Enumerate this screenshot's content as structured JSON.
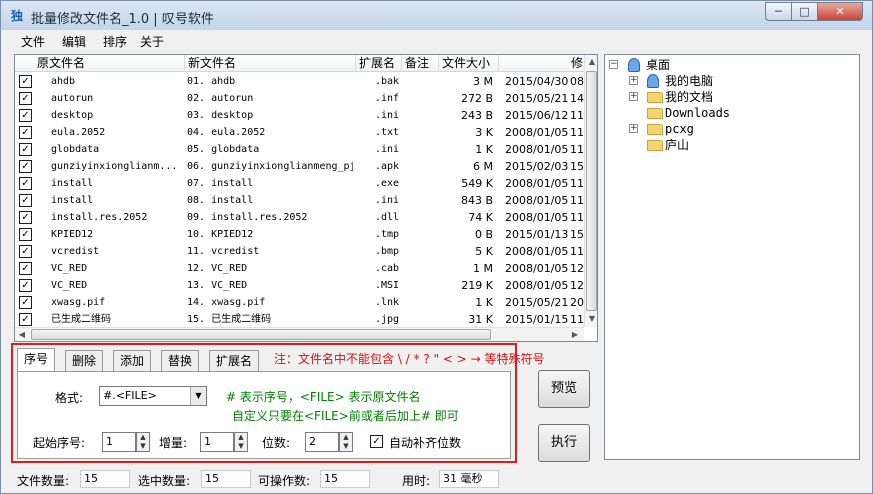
{
  "window": {
    "title": "批量修改文件名_1.0 | 叹号软件",
    "icon_glyph": "独",
    "min_label": "─",
    "max_label": "□",
    "close_label": "✕"
  },
  "menu": [
    "文件",
    "编辑",
    "排序",
    "关于"
  ],
  "columns": [
    "原文件名",
    "新文件名",
    "扩展名",
    "备注",
    "文件大小",
    "修"
  ],
  "rows": [
    {
      "orig": "ahdb",
      "new": "01. ahdb",
      "ext": ".bak",
      "size": "3 M",
      "date": "2015/04/30",
      "tail": "08"
    },
    {
      "orig": "autorun",
      "new": "02. autorun",
      "ext": ".inf",
      "size": "272 B",
      "date": "2015/05/21",
      "tail": "14"
    },
    {
      "orig": "desktop",
      "new": "03. desktop",
      "ext": ".ini",
      "size": "243 B",
      "date": "2015/06/12",
      "tail": "11"
    },
    {
      "orig": "eula.2052",
      "new": "04. eula.2052",
      "ext": ".txt",
      "size": "3 K",
      "date": "2008/01/05",
      "tail": "11"
    },
    {
      "orig": "globdata",
      "new": "05. globdata",
      "ext": ".ini",
      "size": "1 K",
      "date": "2008/01/05",
      "tail": "11"
    },
    {
      "orig": "gunziyinxionglianm...",
      "new": "06. gunziyinxionglianmeng_pj",
      "ext": ".apk",
      "size": "6 M",
      "date": "2015/02/03",
      "tail": "15"
    },
    {
      "orig": "install",
      "new": "07. install",
      "ext": ".exe",
      "size": "549 K",
      "date": "2008/01/05",
      "tail": "11"
    },
    {
      "orig": "install",
      "new": "08. install",
      "ext": ".ini",
      "size": "843 B",
      "date": "2008/01/05",
      "tail": "11"
    },
    {
      "orig": "install.res.2052",
      "new": "09. install.res.2052",
      "ext": ".dll",
      "size": "74 K",
      "date": "2008/01/05",
      "tail": "11"
    },
    {
      "orig": "KPIED12",
      "new": "10. KPIED12",
      "ext": ".tmp",
      "size": "0 B",
      "date": "2015/01/13",
      "tail": "15"
    },
    {
      "orig": "vcredist",
      "new": "11. vcredist",
      "ext": ".bmp",
      "size": "5 K",
      "date": "2008/01/05",
      "tail": "11"
    },
    {
      "orig": "VC_RED",
      "new": "12. VC_RED",
      "ext": ".cab",
      "size": "1 M",
      "date": "2008/01/05",
      "tail": "12"
    },
    {
      "orig": "VC_RED",
      "new": "13. VC_RED",
      "ext": ".MSI",
      "size": "219 K",
      "date": "2008/01/05",
      "tail": "12"
    },
    {
      "orig": "xwasg.pif",
      "new": "14. xwasg.pif",
      "ext": ".lnk",
      "size": "1 K",
      "date": "2015/05/21",
      "tail": "20"
    },
    {
      "orig": "已生成二维码",
      "new": "15. 已生成二维码",
      "ext": ".jpg",
      "size": "31 K",
      "date": "2015/01/15",
      "tail": "11"
    }
  ],
  "tree": {
    "root": "桌面",
    "items": [
      "我的电脑",
      "我的文档",
      "Downloads",
      "pcxg",
      "庐山"
    ]
  },
  "tabs": [
    "序号",
    "删除",
    "添加",
    "替换",
    "扩展名"
  ],
  "note": "注：文件名中不能包含 \\ / * ? \" < > → 等特殊符号",
  "format": {
    "label": "格式:",
    "value": "#.<FILE>",
    "hint1": "# 表示序号，<FILE> 表示原文件名",
    "hint2": "自定义只要在<FILE>前或者后加上# 即可"
  },
  "start": {
    "label": "起始序号:",
    "value": "1"
  },
  "step": {
    "label": "增量:",
    "value": "1"
  },
  "digits": {
    "label": "位数:",
    "value": "2"
  },
  "autopad": {
    "label": "自动补齐位数",
    "checked": true
  },
  "buttons": {
    "preview": "预览",
    "execute": "执行"
  },
  "status": {
    "file_count_label": "文件数量:",
    "file_count": "15",
    "selected_label": "选中数量:",
    "selected": "15",
    "operable_label": "可操作数:",
    "operable": "15",
    "time_label": "用时:",
    "time": "31 毫秒"
  }
}
